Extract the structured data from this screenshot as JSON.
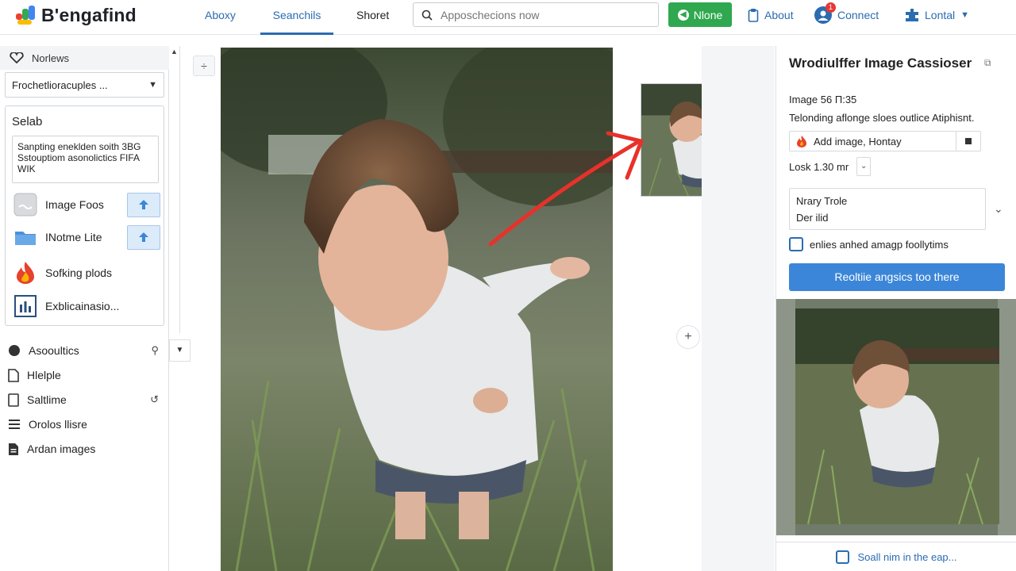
{
  "app": {
    "logo_text": "B'engafind"
  },
  "nav": {
    "tabs": [
      {
        "label": "Aboxy"
      },
      {
        "label": "Seanchils"
      },
      {
        "label": "Shoret"
      }
    ],
    "search_placeholder": "Apposchecions now",
    "green_button": "Nlone",
    "about": "About",
    "connect": "Connect",
    "connect_badge": "1",
    "account": "Lontal"
  },
  "sidebar": {
    "header": "Norlews",
    "select_value": "Frochetlioracuples ...",
    "panel": {
      "title": "Selab",
      "textarea": "Sanpting eneklden soith 3BG Sstouptiom asonolictics FIFA WIK",
      "rows": [
        {
          "label": "Image Foos",
          "icon": "image-placeholder-icon"
        },
        {
          "label": "INotme Lite",
          "icon": "folder-icon"
        },
        {
          "label": "Sofking plods",
          "icon": "flame-icon"
        },
        {
          "label": "Exblicainasio...",
          "icon": "chart-icon"
        }
      ]
    },
    "list": [
      {
        "label": "Asooultics",
        "icon": "circle-icon",
        "trail": "⚲"
      },
      {
        "label": "Hlelple",
        "icon": "document-icon",
        "trail": ""
      },
      {
        "label": "Saltlime",
        "icon": "page-icon",
        "trail": "↺"
      },
      {
        "label": "Orolos llisre",
        "icon": "list-icon",
        "trail": ""
      },
      {
        "label": "Ardan images",
        "icon": "file-icon",
        "trail": ""
      }
    ]
  },
  "canvas": {
    "tool": "÷",
    "zoom": "+"
  },
  "right_panel": {
    "title": "Wrodiulffer Image Cassioser",
    "meta": "Image 56 Π:35",
    "description": "Telonding aflonge sloes outlice Atiphisnt.",
    "add_image": "Add image, Hontay",
    "look": "Losk 1.30 mr",
    "box_line1": "Nrary Trole",
    "box_line2": "Der ilid",
    "checkbox": "enlies anhed amagp foollytims",
    "primary_button": "Reoltiie angsics too there",
    "footer": "Soall nim in the eap..."
  },
  "colors": {
    "accent": "#2b6cb0",
    "green": "#2fa84f",
    "primary_button": "#3b86d8"
  }
}
